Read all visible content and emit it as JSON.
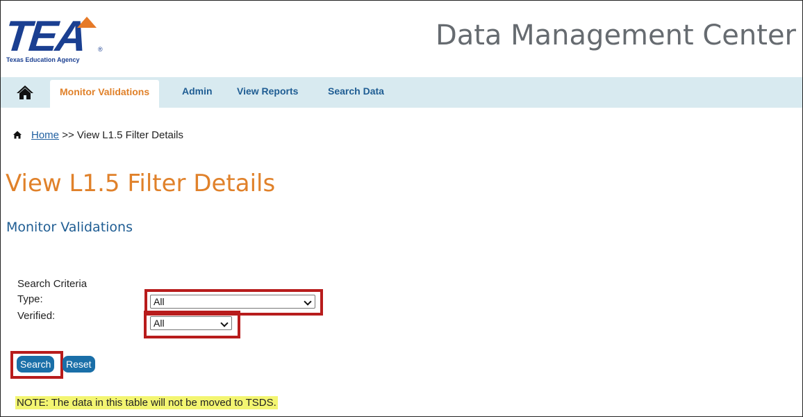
{
  "header": {
    "logo_mark": "TEA",
    "logo_tagline": "Texas Education Agency",
    "logo_reg": "®",
    "site_title": "Data Management Center"
  },
  "nav": {
    "items": [
      {
        "label": "Monitor Validations",
        "active": true
      },
      {
        "label": "Admin"
      },
      {
        "label": "View Reports"
      },
      {
        "label": "Search Data"
      }
    ]
  },
  "breadcrumb": {
    "home_label": "Home",
    "separator": ">>",
    "current": "View L1.5 Filter Details"
  },
  "page": {
    "title": "View L1.5 Filter Details",
    "section": "Monitor Validations"
  },
  "criteria": {
    "heading": "Search Criteria",
    "type_label": "Type:",
    "type_value": "All",
    "verified_label": "Verified:",
    "verified_value": "All"
  },
  "buttons": {
    "search": "Search",
    "reset": "Reset"
  },
  "note": "NOTE: The data in this table will not be moved to TSDS.",
  "colors": {
    "accent_orange": "#e0812a",
    "brand_blue": "#1a3f91",
    "nav_bg": "#d8eaf0",
    "highlight_red": "#b81c1c",
    "note_bg": "#f3f571"
  }
}
